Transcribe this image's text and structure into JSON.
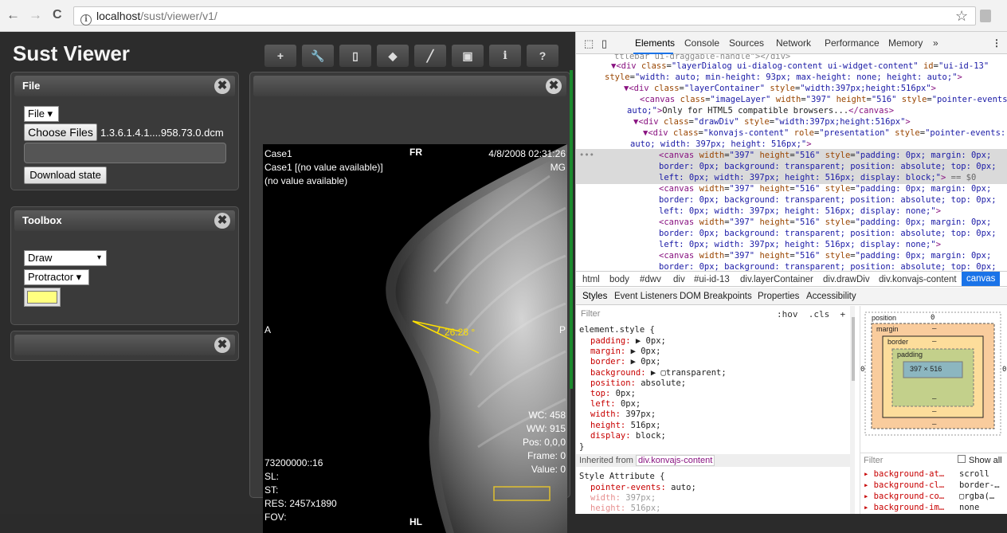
{
  "browser": {
    "back": "←",
    "forward": "→",
    "reload": "C",
    "url_info": "i",
    "url_host": "localhost",
    "url_path": "/sust/viewer/v1/",
    "star": "☆"
  },
  "app": {
    "title": "Sust Viewer",
    "toolbar": [
      "+",
      "🔧",
      "▯",
      "◆",
      "╱",
      "▣",
      "i",
      "?"
    ],
    "file_panel": {
      "title": "File",
      "close": "✖",
      "file_select": "File ▾",
      "choose_files": "Choose Files",
      "file_name": "1.3.6.1.4.1....958.73.0.dcm",
      "download_state": "Download state"
    },
    "toolbox_panel": {
      "title": "Toolbox",
      "close": "✖",
      "draw_select": "Draw",
      "draw_arrow": "▾",
      "protractor_select": "Protractor ▾",
      "color": "#ffff80"
    },
    "empty_panel": {
      "close": "✖"
    },
    "viewer": {
      "close": "✖",
      "top_left": [
        "Case1",
        "Case1 [(no value available)]",
        "(no value available)"
      ],
      "top_center": "FR",
      "top_right": [
        "4/8/2008 02:31:26",
        "MG"
      ],
      "left_mid": "A",
      "right_mid": "P",
      "angle_label": "26.28 °",
      "bottom_right": [
        "WC: 458",
        "WW: 915",
        "Pos: 0,0,0",
        "Frame: 0",
        "Value: 0"
      ],
      "bottom_left": [
        "73200000::16",
        "SL:",
        "ST:",
        "RES: 2457x1890",
        "FOV:"
      ],
      "bottom_center": "HL"
    }
  },
  "devtools": {
    "tabs": [
      "Elements",
      "Console",
      "Sources",
      "Network",
      "Performance",
      "Memory",
      "»"
    ],
    "breadcrumb": [
      "html",
      "body",
      "#dwv",
      "div",
      "#ui-id-13",
      "div.layerContainer",
      "div.drawDiv",
      "div.konvajs-content",
      "canvas"
    ],
    "subtabs": [
      "Styles",
      "Event Listeners",
      "DOM Breakpoints",
      "Properties",
      "Accessibility"
    ],
    "filter_placeholder": "Filter",
    "hov_cls": ":hov  .cls  +",
    "element_style_header": "element.style {",
    "element_style": [
      [
        "padding",
        "▶ 0px;"
      ],
      [
        "margin",
        "▶ 0px;"
      ],
      [
        "border",
        "▶ 0px;"
      ],
      [
        "background",
        "▶ ▢transparent;"
      ],
      [
        "position",
        "absolute;"
      ],
      [
        "top",
        "0px;"
      ],
      [
        "left",
        "0px;"
      ],
      [
        "width",
        "397px;"
      ],
      [
        "height",
        "516px;"
      ],
      [
        "display",
        "block;"
      ]
    ],
    "inherited_from": "Inherited from",
    "inherited_sel": "div.konvajs-content",
    "style_attr": "Style Attribute {",
    "style_attr_lines": [
      [
        "pointer-events",
        "auto;"
      ],
      [
        "width",
        "397px;"
      ],
      [
        "height",
        "516px;"
      ]
    ],
    "box": {
      "position": "position",
      "pos_val": "0",
      "margin": "margin",
      "border": "border",
      "padding": "padding",
      "dash": "–",
      "content": "397 × 516",
      "zero": "0"
    },
    "computed_filter": "Filter",
    "show_all": "Show all",
    "computed": [
      [
        "background-at…",
        "scroll"
      ],
      [
        "background-cl…",
        "border-…"
      ],
      [
        "background-co…",
        "▢rgba(…"
      ],
      [
        "background-im…",
        "none"
      ]
    ]
  }
}
